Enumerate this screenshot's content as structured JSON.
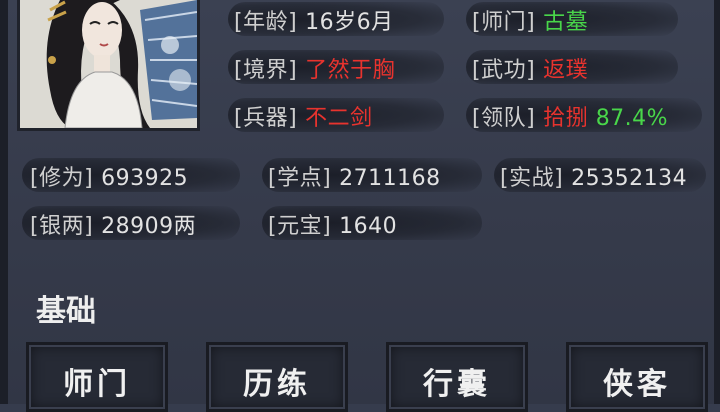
{
  "profile": {
    "age_label": "[年龄]",
    "age_value": "16岁6月",
    "sect_label": "[师门]",
    "sect_value": "古墓",
    "realm_label": "[境界]",
    "realm_value": "了然于胸",
    "skill_label": "[武功]",
    "skill_value": "返璞",
    "weapon_label": "[兵器]",
    "weapon_value": "不二剑",
    "lead_label": "[领队]",
    "lead_value": "拾捌",
    "lead_percent": "87.4%"
  },
  "stats": {
    "cultivation_label": "[修为]",
    "cultivation_value": "693925",
    "learn_label": "[学点]",
    "learn_value": "2711168",
    "combat_label": "[实战]",
    "combat_value": "25352134",
    "silver_label": "[银两]",
    "silver_value": "28909两",
    "ingot_label": "[元宝]",
    "ingot_value": "1640"
  },
  "section": {
    "title": "基础"
  },
  "buttons": [
    {
      "label": "师门"
    },
    {
      "label": "历练"
    },
    {
      "label": "行囊"
    },
    {
      "label": "侠客"
    }
  ],
  "colors": {
    "background": "#363c4d",
    "value_red": "#e8332e",
    "value_green": "#49d64a",
    "text_light": "#d9d9d9"
  }
}
